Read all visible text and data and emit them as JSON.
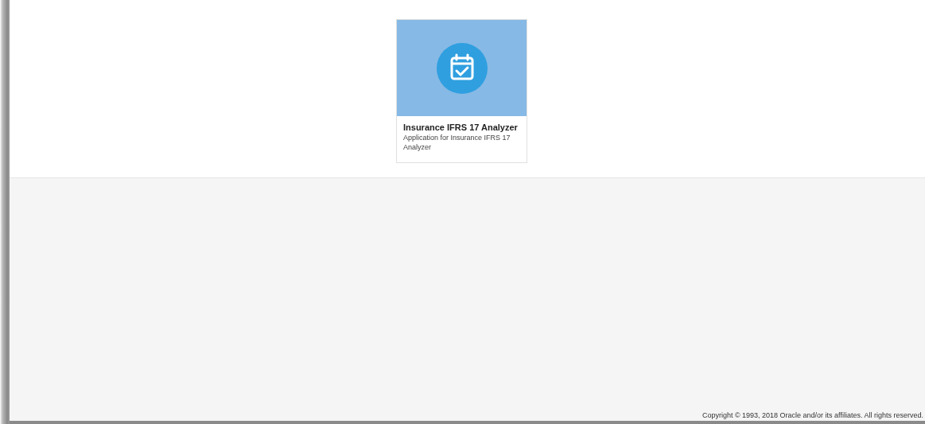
{
  "apps": [
    {
      "title": "Insurance IFRS 17 Analyzer",
      "description": "Application for Insurance IFRS 17 Analyzer"
    }
  ],
  "footer": {
    "copyright": "Copyright © 1993, 2018 Oracle and/or its affiliates. All rights reserved."
  }
}
